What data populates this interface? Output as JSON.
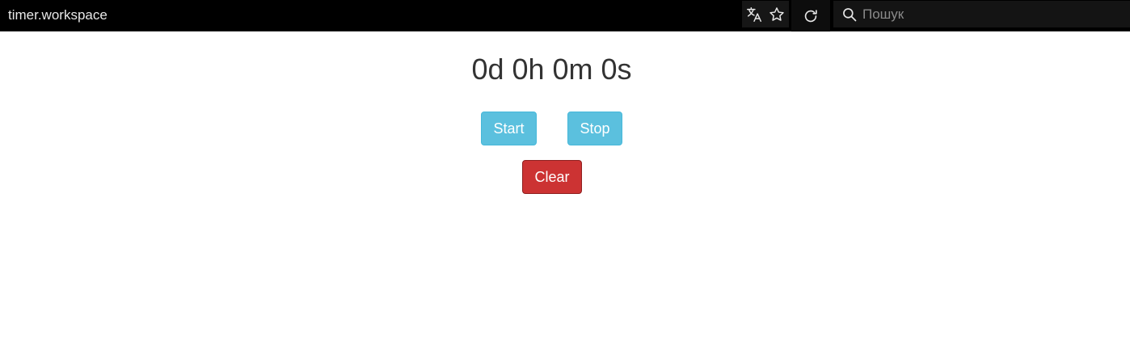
{
  "browser": {
    "url": "timer.workspace",
    "search_placeholder": "Пошук",
    "icons": {
      "translate": "translate-icon",
      "bookmark": "star-icon",
      "reload": "reload-icon",
      "search": "search-icon"
    }
  },
  "timer": {
    "display": "0d 0h 0m 0s"
  },
  "controls": {
    "start_label": "Start",
    "stop_label": "Stop",
    "clear_label": "Clear"
  },
  "colors": {
    "info": "#5bc0de",
    "danger": "#cc3333",
    "bar_background": "#000000"
  }
}
